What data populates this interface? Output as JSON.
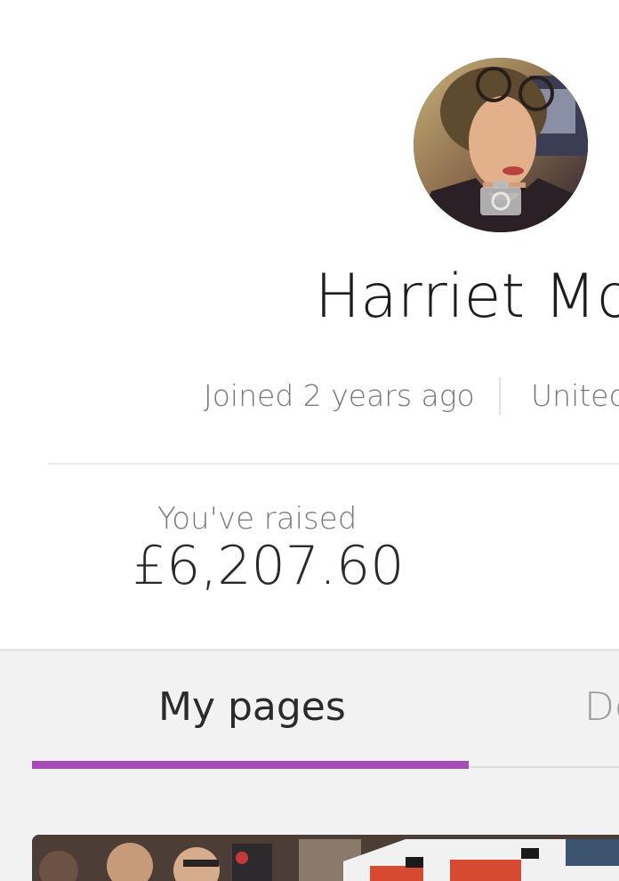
{
  "profile": {
    "name": "Harriet Mor",
    "joined": "Joined 2 years ago",
    "location": "United"
  },
  "stats": {
    "raised_label": "You've raised",
    "raised_amount": "£6,207.60"
  },
  "tabs": [
    {
      "label": "My pages",
      "active": true
    },
    {
      "label": "Do",
      "active": false
    }
  ],
  "icons": {
    "avatar": "profile-photo",
    "camera": "camera-icon"
  },
  "colors": {
    "accent": "#a64db5",
    "section_bg": "#f2f2f2"
  }
}
